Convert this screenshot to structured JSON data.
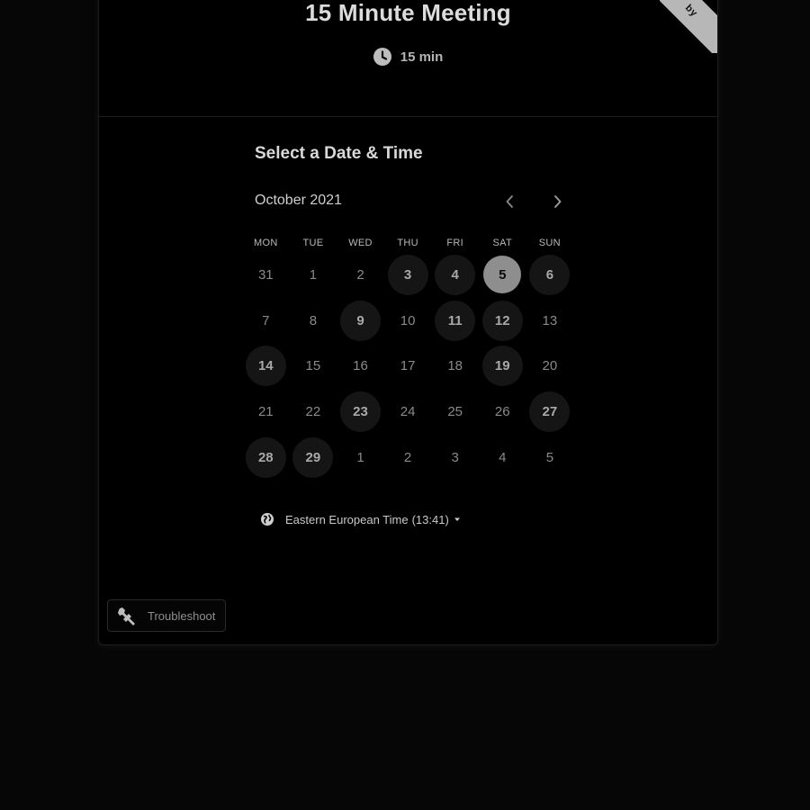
{
  "event": {
    "title": "15 Minute Meeting",
    "duration": "15 min",
    "duration_icon": "clock-icon"
  },
  "ribbon": {
    "text": "by"
  },
  "scheduler": {
    "title": "Select a Date & Time",
    "month": "October 2021",
    "prev_icon": "chevron-left-icon",
    "next_icon": "chevron-right-icon",
    "weekdays": [
      "MON",
      "TUE",
      "WED",
      "THU",
      "FRI",
      "SAT",
      "SUN"
    ],
    "weeks": [
      [
        {
          "d": "31",
          "s": "outside"
        },
        {
          "d": "1",
          "s": "off"
        },
        {
          "d": "2",
          "s": "off"
        },
        {
          "d": "3",
          "s": "available"
        },
        {
          "d": "4",
          "s": "available"
        },
        {
          "d": "5",
          "s": "selected"
        },
        {
          "d": "6",
          "s": "available"
        }
      ],
      [
        {
          "d": "7",
          "s": "off"
        },
        {
          "d": "8",
          "s": "off"
        },
        {
          "d": "9",
          "s": "available"
        },
        {
          "d": "10",
          "s": "off"
        },
        {
          "d": "11",
          "s": "available"
        },
        {
          "d": "12",
          "s": "available"
        },
        {
          "d": "13",
          "s": "off"
        }
      ],
      [
        {
          "d": "14",
          "s": "available"
        },
        {
          "d": "15",
          "s": "off"
        },
        {
          "d": "16",
          "s": "off"
        },
        {
          "d": "17",
          "s": "off"
        },
        {
          "d": "18",
          "s": "off"
        },
        {
          "d": "19",
          "s": "available"
        },
        {
          "d": "20",
          "s": "off"
        }
      ],
      [
        {
          "d": "21",
          "s": "off"
        },
        {
          "d": "22",
          "s": "off"
        },
        {
          "d": "23",
          "s": "available"
        },
        {
          "d": "24",
          "s": "off"
        },
        {
          "d": "25",
          "s": "off"
        },
        {
          "d": "26",
          "s": "off"
        },
        {
          "d": "27",
          "s": "available"
        }
      ],
      [
        {
          "d": "28",
          "s": "available"
        },
        {
          "d": "29",
          "s": "available"
        },
        {
          "d": "1",
          "s": "outside"
        },
        {
          "d": "2",
          "s": "outside"
        },
        {
          "d": "3",
          "s": "outside"
        },
        {
          "d": "4",
          "s": "outside"
        },
        {
          "d": "5",
          "s": "outside"
        }
      ]
    ],
    "timezone": {
      "label": "Eastern European Time",
      "time": "(13:41)",
      "icon": "globe-icon"
    }
  },
  "troubleshoot": {
    "label": "Troubleshoot",
    "icon": "wrench-icon"
  },
  "colors": {
    "background": "#060606",
    "card": "#000000",
    "available_day": "#151515",
    "selected_day": "#8e8e8e",
    "ribbon": "#b7b7b7"
  }
}
